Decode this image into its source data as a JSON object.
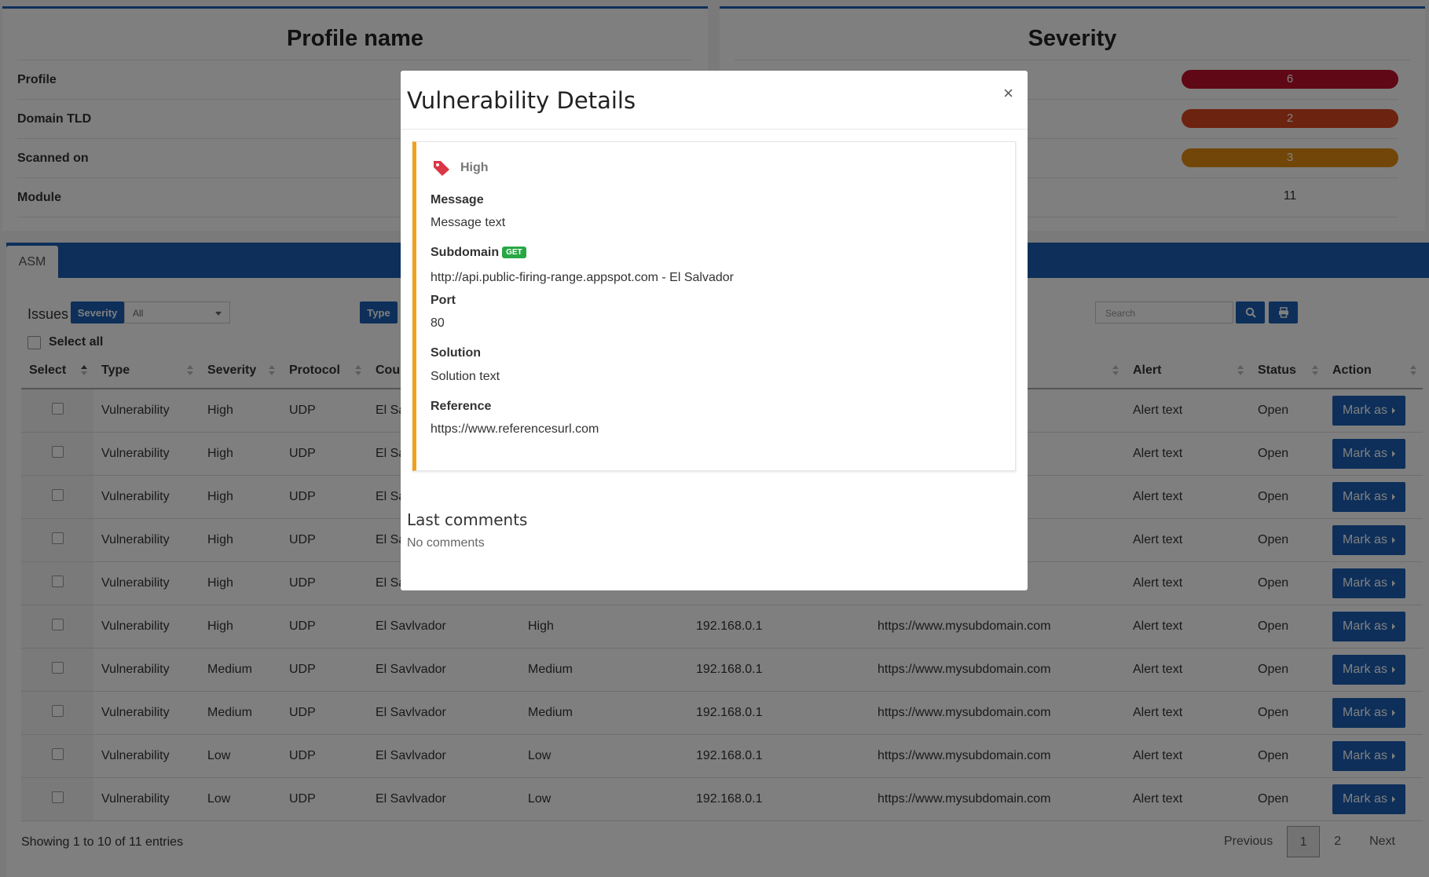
{
  "profile_card": {
    "title": "Profile name",
    "rows": [
      "Profile",
      "Domain TLD",
      "Scanned on",
      "Module"
    ]
  },
  "severity_card": {
    "title": "Severity",
    "rows": [
      {
        "value": "6",
        "color": "#c0102b"
      },
      {
        "value": "2",
        "color": "#d9471e"
      },
      {
        "value": "3",
        "color": "#e38c11"
      },
      {
        "value": "11",
        "color": ""
      }
    ]
  },
  "tabs": [
    "ASM"
  ],
  "filters": {
    "issues_label": "Issues",
    "severity_btn": "Severity",
    "severity_select": "All",
    "type_btn": "Type",
    "search_placeholder": "Search",
    "select_all": "Select all"
  },
  "table": {
    "columns": [
      "Select",
      "Type",
      "Severity",
      "Protocol",
      "Cou",
      "",
      "",
      "",
      "Alert",
      "Status",
      "Action"
    ],
    "rows": [
      {
        "type": "Vulnerability",
        "severity": "High",
        "protocol": "UDP",
        "country": "El Sa",
        "sev2": "",
        "ip": "",
        "subdomain": "com",
        "alert": "Alert text",
        "status": "Open",
        "action": "Mark as"
      },
      {
        "type": "Vulnerability",
        "severity": "High",
        "protocol": "UDP",
        "country": "El Sa",
        "sev2": "",
        "ip": "",
        "subdomain": "com",
        "alert": "Alert text",
        "status": "Open",
        "action": "Mark as"
      },
      {
        "type": "Vulnerability",
        "severity": "High",
        "protocol": "UDP",
        "country": "El Sa",
        "sev2": "",
        "ip": "",
        "subdomain": "com",
        "alert": "Alert text",
        "status": "Open",
        "action": "Mark as"
      },
      {
        "type": "Vulnerability",
        "severity": "High",
        "protocol": "UDP",
        "country": "El Sa",
        "sev2": "",
        "ip": "",
        "subdomain": "com",
        "alert": "Alert text",
        "status": "Open",
        "action": "Mark as"
      },
      {
        "type": "Vulnerability",
        "severity": "High",
        "protocol": "UDP",
        "country": "El Sa",
        "sev2": "",
        "ip": "",
        "subdomain": "com",
        "alert": "Alert text",
        "status": "Open",
        "action": "Mark as"
      },
      {
        "type": "Vulnerability",
        "severity": "High",
        "protocol": "UDP",
        "country": "El Savlvador",
        "sev2": "High",
        "ip": "192.168.0.1",
        "subdomain": "https://www.mysubdomain.com",
        "alert": "Alert text",
        "status": "Open",
        "action": "Mark as"
      },
      {
        "type": "Vulnerability",
        "severity": "Medium",
        "protocol": "UDP",
        "country": "El Savlvador",
        "sev2": "Medium",
        "ip": "192.168.0.1",
        "subdomain": "https://www.mysubdomain.com",
        "alert": "Alert text",
        "status": "Open",
        "action": "Mark as"
      },
      {
        "type": "Vulnerability",
        "severity": "Medium",
        "protocol": "UDP",
        "country": "El Savlvador",
        "sev2": "Medium",
        "ip": "192.168.0.1",
        "subdomain": "https://www.mysubdomain.com",
        "alert": "Alert text",
        "status": "Open",
        "action": "Mark as"
      },
      {
        "type": "Vulnerability",
        "severity": "Low",
        "protocol": "UDP",
        "country": "El Savlvador",
        "sev2": "Low",
        "ip": "192.168.0.1",
        "subdomain": "https://www.mysubdomain.com",
        "alert": "Alert text",
        "status": "Open",
        "action": "Mark as"
      },
      {
        "type": "Vulnerability",
        "severity": "Low",
        "protocol": "UDP",
        "country": "El Savlvador",
        "sev2": "Low",
        "ip": "192.168.0.1",
        "subdomain": "https://www.mysubdomain.com",
        "alert": "Alert text",
        "status": "Open",
        "action": "Mark as"
      }
    ]
  },
  "footer": {
    "info": "Showing 1 to 10 of 11 entries",
    "previous": "Previous",
    "pages": [
      "1",
      "2"
    ],
    "next": "Next"
  },
  "modal": {
    "title": "Vulnerability Details",
    "close": "×",
    "severity": "High",
    "severity_icon": "tag-icon",
    "message_label": "Message",
    "message_value": "Message text",
    "subdomain_label": "Subdomain",
    "subdomain_badge": "GET",
    "subdomain_value": "http://api.public-firing-range.appspot.com - El Salvador",
    "port_label": "Port",
    "port_value": "80",
    "solution_label": "Solution",
    "solution_value": "Solution text",
    "reference_label": "Reference",
    "reference_value": "https://www.referencesurl.com",
    "last_comments": "Last comments",
    "no_comments": "No comments"
  }
}
